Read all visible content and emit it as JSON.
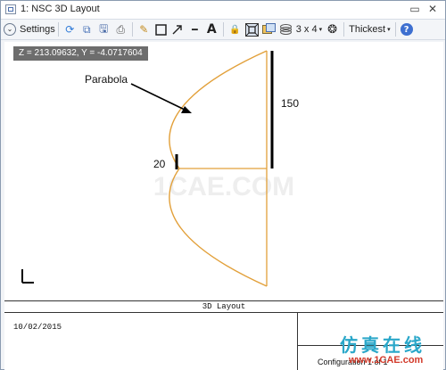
{
  "window": {
    "title": "1: NSC 3D Layout",
    "controls": {
      "minimize": "▭",
      "close": "✕"
    }
  },
  "toolbar": {
    "settings_label": "Settings",
    "settings_icon": "⌄",
    "grid_label": "3 x 4",
    "grid_caret": "▾",
    "thickness_label": "Thickest",
    "thickness_caret": "▾",
    "icons": {
      "refresh": "⟳",
      "copy": "⧉",
      "save": "🖫",
      "print": "⎙",
      "pencil": "✎",
      "line": "━",
      "text": "A",
      "lock": "🔒",
      "settings_circle": "❂",
      "help": "?"
    }
  },
  "canvas": {
    "coordinate_readout": "Z = 213.09632, Y = -4.0717604",
    "annotations": {
      "parabola_label": "Parabola",
      "dimension_150": "150",
      "dimension_20": "20"
    },
    "watermark": "1CAE.COM",
    "colors": {
      "parabola": "#e2a03a",
      "lines": "#e2a03a",
      "bars": "#000000"
    }
  },
  "title_block": {
    "header": "3D Layout",
    "date": "10/02/2015",
    "config": "Configuration 1 of 1"
  },
  "watermark_brand": {
    "logo": "仿真在线",
    "site": "www.1CAE.com"
  }
}
